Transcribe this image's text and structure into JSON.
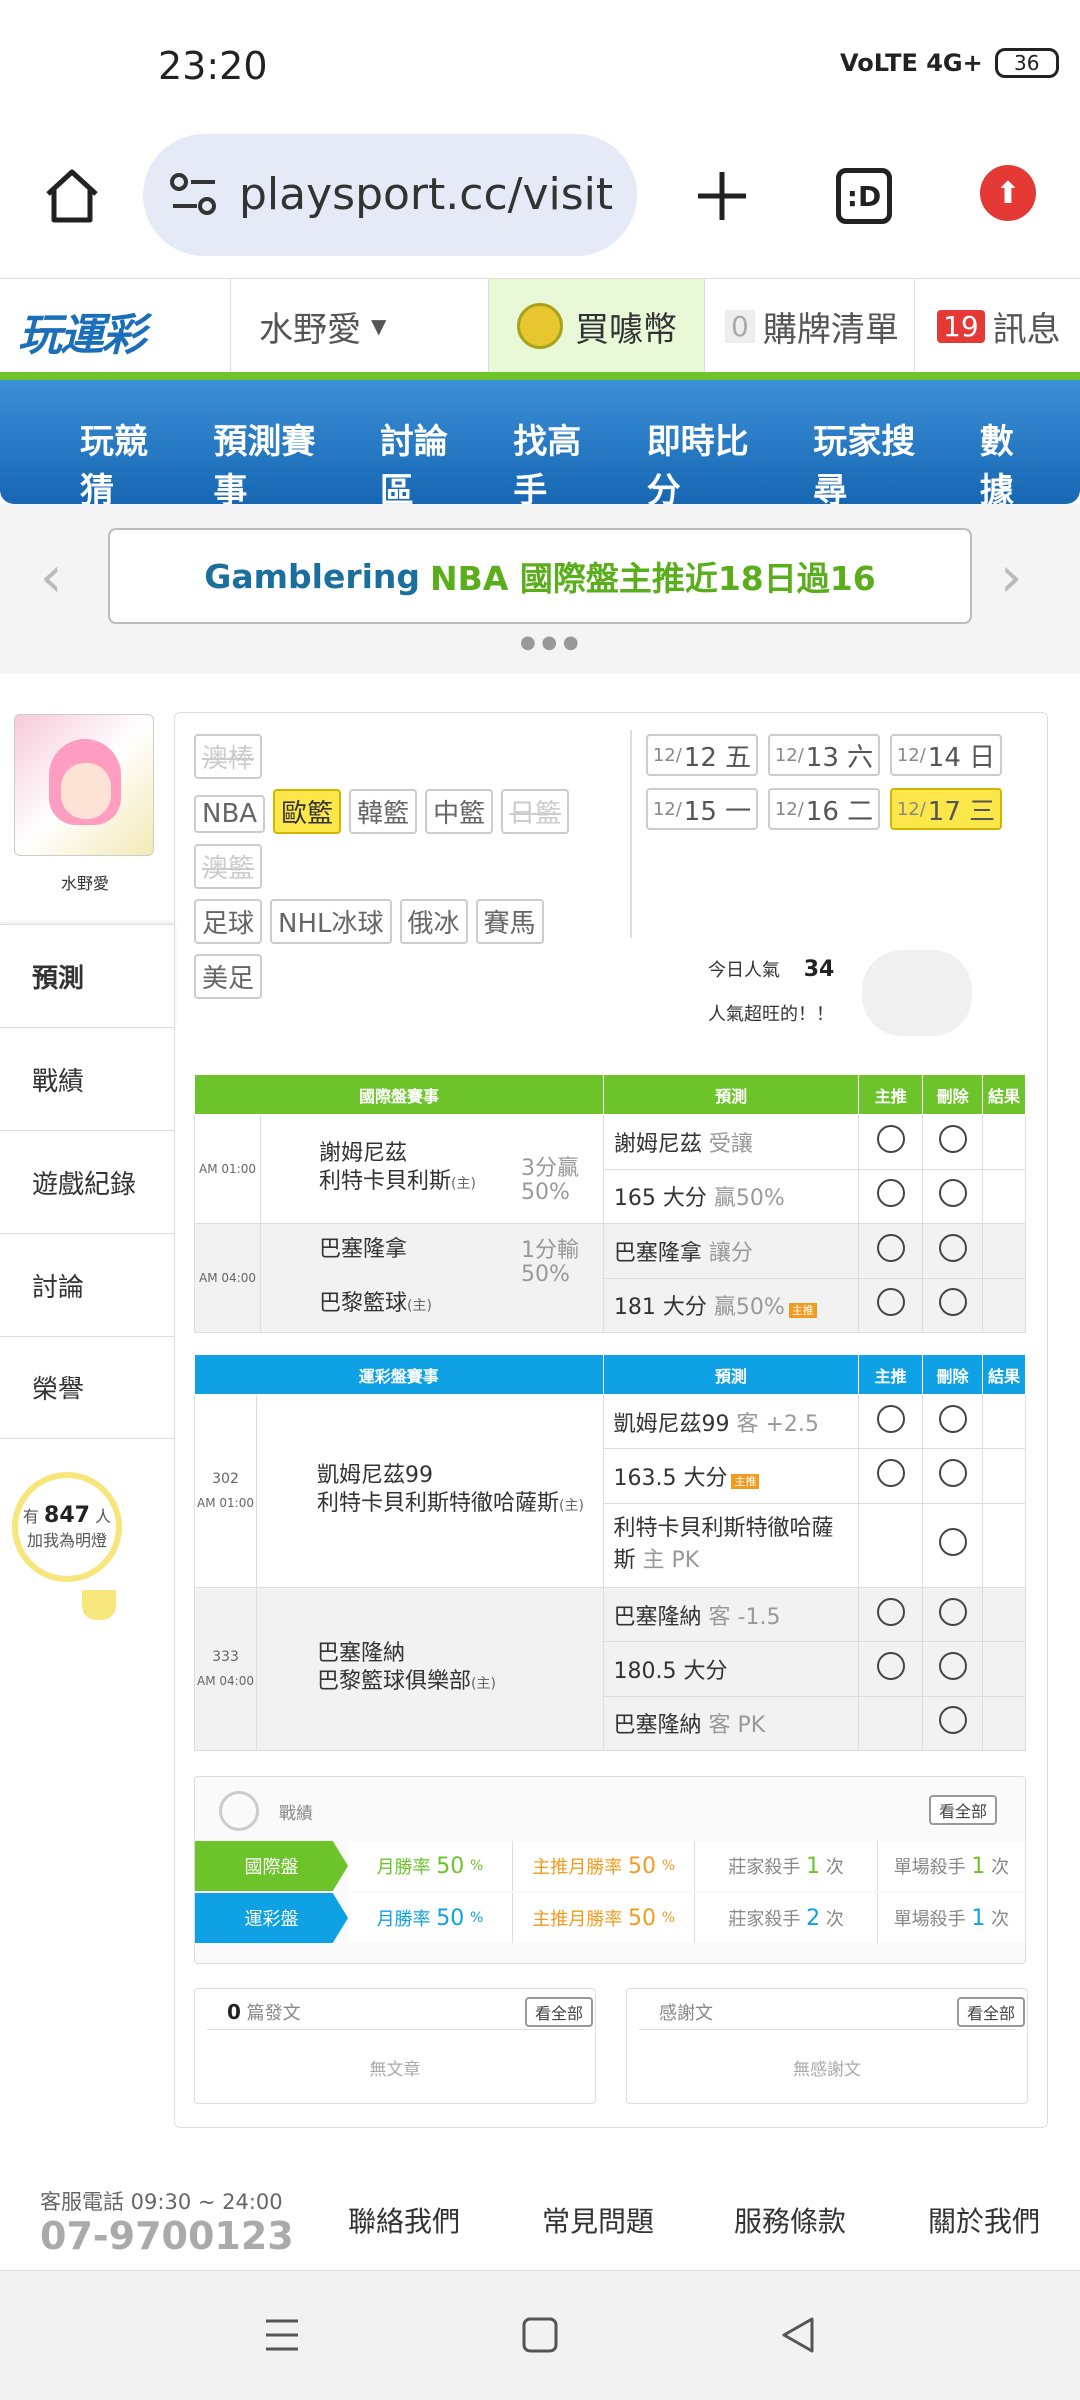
{
  "status": {
    "time": "23:20",
    "network": "VoLTE 4G+",
    "battery": "36"
  },
  "browser": {
    "url": "playsport.cc/visit",
    "tab_label": ":D"
  },
  "site": {
    "logo": "玩運彩",
    "user": "水野愛",
    "buy_label": "買噱幣",
    "cart_count": "0",
    "cart_label": "購牌清單",
    "msg_count": "19",
    "msg_label": "訊息"
  },
  "nav": [
    "玩競猜",
    "預測賽事",
    "討論區",
    "找高手",
    "即時比分",
    "玩家搜尋",
    "數據"
  ],
  "promo": {
    "part1": "Gamblering",
    "part2": "NBA 國際盤主推近18日過16"
  },
  "sidebar": {
    "name": "水野愛",
    "items": [
      "預測",
      "戰績",
      "遊戲紀錄",
      "討論",
      "榮譽"
    ],
    "bulb_pre": "有",
    "bulb_count": "847",
    "bulb_unit": "人",
    "bulb_text": "加我為明燈"
  },
  "leagues": {
    "row1": [
      "澳棒"
    ],
    "row2": [
      "NBA",
      "歐籃",
      "韓籃",
      "中籃",
      "日籃"
    ],
    "row3": [
      "澳籃"
    ],
    "row4": [
      "足球",
      "NHL冰球",
      "俄冰",
      "賽馬",
      "美足"
    ]
  },
  "dates": [
    {
      "m": "12/",
      "d": "12 五"
    },
    {
      "m": "12/",
      "d": "13 六"
    },
    {
      "m": "12/",
      "d": "14 日"
    },
    {
      "m": "12/",
      "d": "15 一"
    },
    {
      "m": "12/",
      "d": "16 二"
    },
    {
      "m": "12/",
      "d": "17 三"
    }
  ],
  "popularity": {
    "label": "今日人氣",
    "value": "34",
    "note": "人氣超旺的！！"
  },
  "intl_table": {
    "headers": [
      "國際盤賽事",
      "預測",
      "主推",
      "刪除",
      "結果"
    ],
    "games": [
      {
        "time": "AM 01:00",
        "team1": "謝姆尼茲",
        "team2": "利特卡貝利斯",
        "home_mark": "(主)",
        "spread": "3分贏",
        "pct": "50%",
        "picks": [
          {
            "team": "謝姆尼茲",
            "note": "受讓"
          },
          {
            "team": "165 大分",
            "note": "贏50%"
          }
        ]
      },
      {
        "time": "AM 04:00",
        "team1": "巴塞隆拿",
        "team2": "巴黎籃球",
        "home_mark": "(主)",
        "spread": "1分輸",
        "pct": "50%",
        "picks": [
          {
            "team": "巴塞隆拿",
            "note": "讓分"
          },
          {
            "team": "181 大分",
            "note": "贏50%",
            "badge": "主推"
          }
        ]
      }
    ]
  },
  "lottery_table": {
    "headers": [
      "運彩盤賽事",
      "預測",
      "主推",
      "刪除",
      "結果"
    ],
    "games": [
      {
        "num": "302",
        "time": "AM 01:00",
        "team1": "凱姆尼茲99",
        "team2": "利特卡貝利斯特徹哈薩斯",
        "home_mark": "(主)",
        "picks": [
          {
            "team": "凱姆尼茲99",
            "note": "客 +2.5"
          },
          {
            "team": "163.5 大分",
            "note": "",
            "badge": "主推"
          },
          {
            "team": "利特卡貝利斯特徹哈薩斯",
            "note": "主 PK"
          }
        ]
      },
      {
        "num": "333",
        "time": "AM 04:00",
        "team1": "巴塞隆納",
        "team2": "巴黎籃球俱樂部",
        "home_mark": "(主)",
        "picks": [
          {
            "team": "巴塞隆納",
            "note": "客 -1.5"
          },
          {
            "team": "180.5 大分",
            "note": ""
          },
          {
            "team": "巴塞隆納",
            "note": "客 PK"
          }
        ]
      }
    ]
  },
  "stats": {
    "title": "戰績",
    "view_all": "看全部",
    "rows": [
      {
        "label": "國際盤",
        "win_label": "月勝率",
        "win": "50",
        "main_label": "主推月勝率",
        "main": "50",
        "pct": "%",
        "kill_label": "莊家殺手",
        "kill": "1",
        "single_label": "單場殺手",
        "single": "1",
        "unit": "次"
      },
      {
        "label": "運彩盤",
        "win_label": "月勝率",
        "win": "50",
        "main_label": "主推月勝率",
        "main": "50",
        "pct": "%",
        "kill_label": "莊家殺手",
        "kill": "2",
        "single_label": "單場殺手",
        "single": "1",
        "unit": "次"
      }
    ]
  },
  "posts": {
    "count": "0",
    "label": "篇發文",
    "view_all": "看全部",
    "empty": "無文章"
  },
  "thanks": {
    "label": "感謝文",
    "view_all": "看全部",
    "empty": "無感謝文"
  },
  "footer": {
    "hours": "客服電話 09:30 ~ 24:00",
    "phone": "07-9700123",
    "links": [
      "聯絡我們",
      "常見問題",
      "服務條款",
      "關於我們"
    ]
  },
  "colors": {
    "green": "#6cc42a",
    "blue": "#0ea1e4",
    "yellow": "#fbe74a",
    "nav": "#1767b3"
  }
}
